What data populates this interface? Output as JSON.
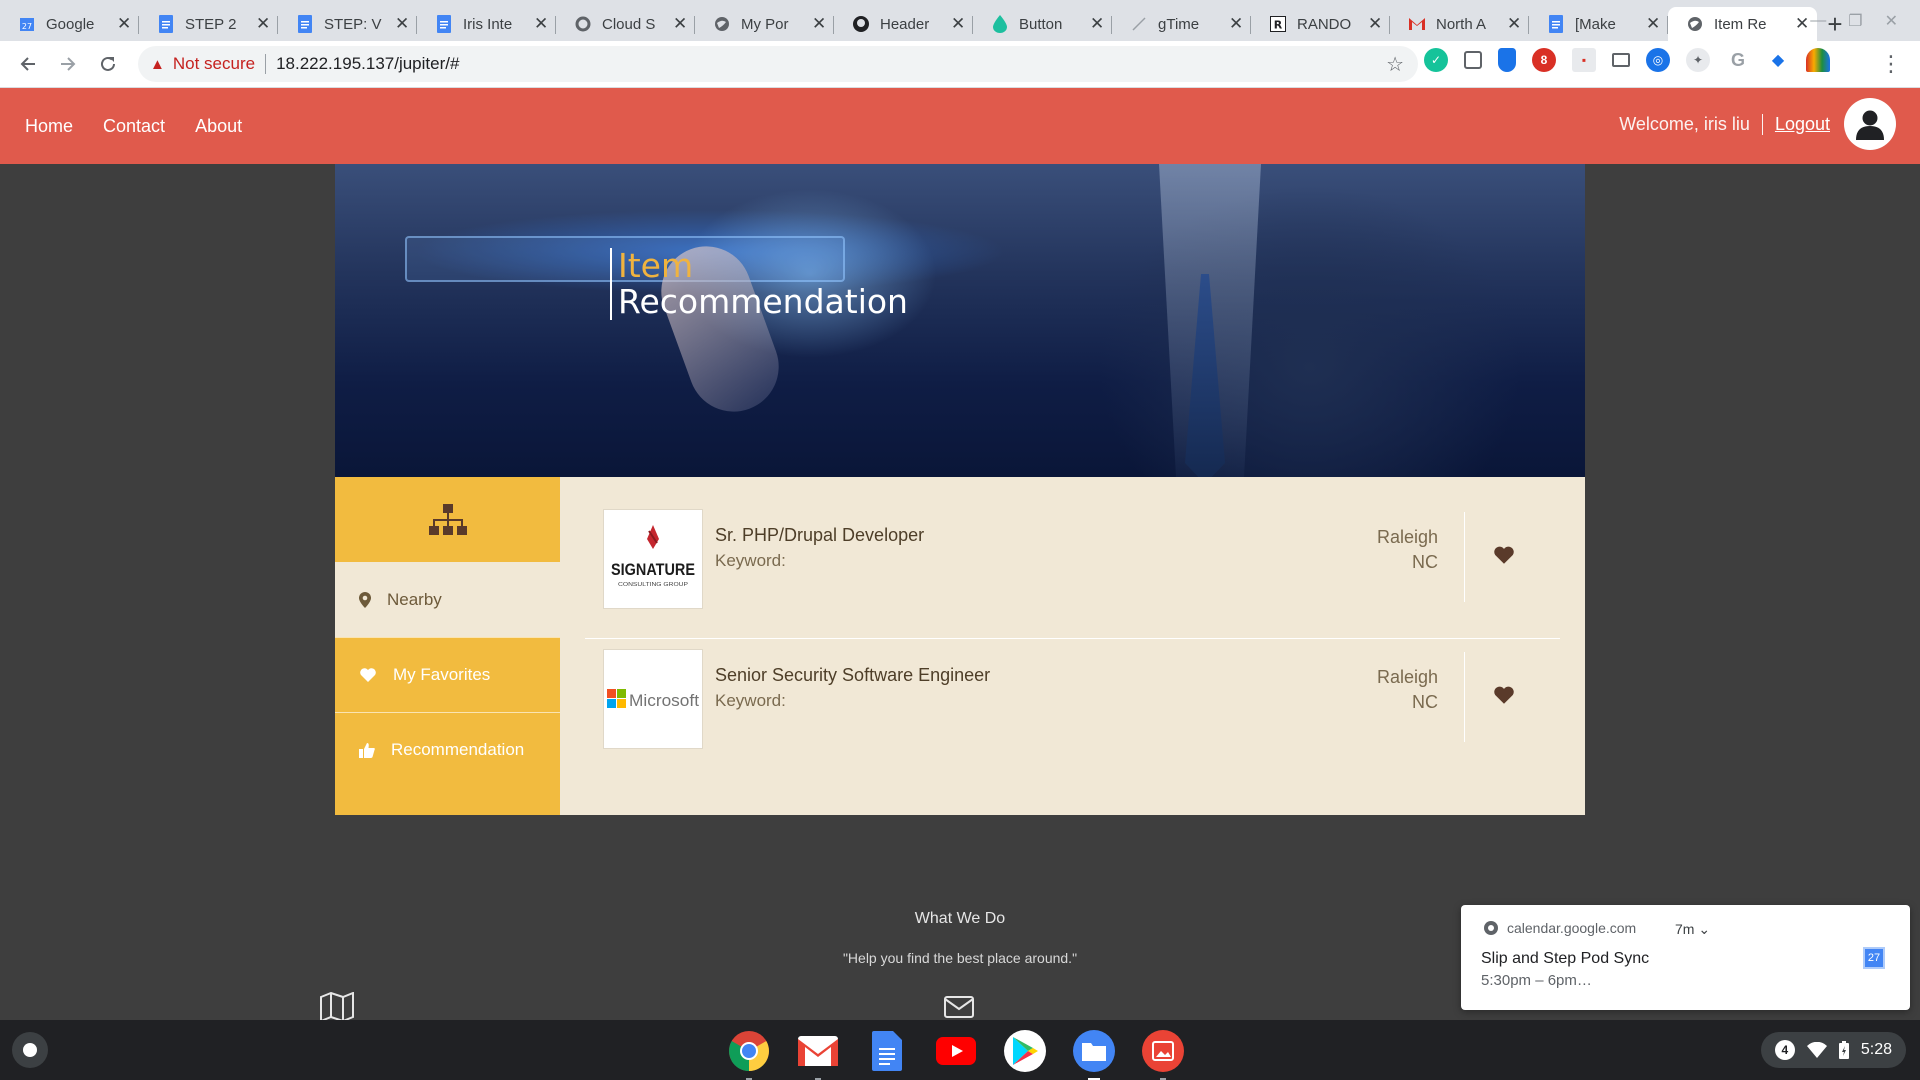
{
  "browser": {
    "tabs": [
      {
        "title": "Google",
        "icon": "calendar-icon",
        "color": "#4285f4"
      },
      {
        "title": "STEP 2",
        "icon": "docs-icon",
        "color": "#4285f4"
      },
      {
        "title": "STEP: V",
        "icon": "docs-icon",
        "color": "#4285f4"
      },
      {
        "title": "Iris Inte",
        "icon": "docs-icon",
        "color": "#4285f4"
      },
      {
        "title": "Cloud S",
        "icon": "cloud-icon",
        "color": "#5f6368"
      },
      {
        "title": "My Por",
        "icon": "globe-icon",
        "color": "#5f6368"
      },
      {
        "title": "Header",
        "icon": "github-icon",
        "color": "#202124"
      },
      {
        "title": "Button",
        "icon": "drop-icon",
        "color": "#1dbf9f"
      },
      {
        "title": "gTime",
        "icon": "pen-icon",
        "color": "#9aa0a6"
      },
      {
        "title": "RANDO",
        "icon": "r-icon",
        "color": "#202124"
      },
      {
        "title": "North A",
        "icon": "gmail-icon",
        "color": "#d93025"
      },
      {
        "title": "[Make",
        "icon": "docs-icon",
        "color": "#4285f4"
      },
      {
        "title": "Item Re",
        "icon": "globe-icon",
        "color": "#5f6368",
        "active": true
      }
    ],
    "not_secure_label": "Not secure",
    "url": "18.222.195.137/jupiter/#"
  },
  "site": {
    "nav": [
      "Home",
      "Contact",
      "About"
    ],
    "welcome": "Welcome, iris liu",
    "logout": "Logout",
    "hero_title_1": "Item",
    "hero_title_2": "Recommendation"
  },
  "sidebar": {
    "items": [
      {
        "label": "Nearby",
        "icon": "map-marker-icon"
      },
      {
        "label": "My Favorites",
        "icon": "heart-icon"
      },
      {
        "label": "Recommendation",
        "icon": "thumbs-up-icon"
      }
    ],
    "top_icon": "sitemap-icon"
  },
  "items": [
    {
      "title": "Sr. PHP/Drupal Developer",
      "keyword": "Keyword:",
      "city": "Raleigh",
      "state": "NC",
      "logo_text": "SIGNATURE",
      "logo_sub": "CONSULTING GROUP"
    },
    {
      "title": "Senior Security Software Engineer",
      "keyword": "Keyword:",
      "city": "Raleigh",
      "state": "NC",
      "logo_text": "Microsoft"
    }
  ],
  "footer": {
    "title": "What We Do",
    "quote": "\"Help you find the best place around.\""
  },
  "notification": {
    "source": "calendar.google.com",
    "time": "7m",
    "title": "Slip and Step Pod Sync",
    "subtitle": "5:30pm – 6pm…",
    "cal_day": "27"
  },
  "shelf": {
    "apps": [
      "chrome-icon",
      "gmail-icon",
      "docs-icon",
      "youtube-icon",
      "play-store-icon",
      "files-icon",
      "gallery-icon"
    ],
    "notification_count": "4",
    "time": "5:28"
  },
  "colors": {
    "header": "#e05a4c",
    "sidebar": "#f2bb3f",
    "content_bg": "#f1e8d6",
    "heart": "#5a3a2a"
  }
}
